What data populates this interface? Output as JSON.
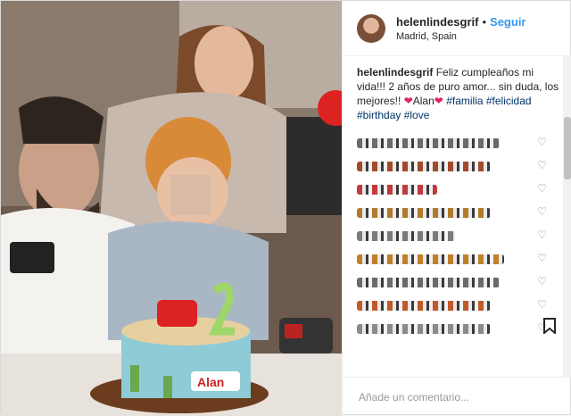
{
  "header": {
    "username": "helenlindesgrif",
    "dot": "•",
    "follow": "Seguir",
    "location": "Madrid, Spain"
  },
  "caption": {
    "username": "helenlindesgrif",
    "text_1": "Feliz cumpleaños mi vida!!! 2 años de puro amor... sin duda, los mejores!! ",
    "heart": "❤",
    "name": "Alan",
    "heart2": "❤",
    "tags": "#familia #felicidad #birthday #love"
  },
  "comments": [
    {
      "blur_color": "#6a6a6a"
    },
    {
      "blur_color": "#a34a2a"
    },
    {
      "blur_color": "#c23a3a"
    },
    {
      "blur_color": "#b07b2a"
    },
    {
      "blur_color": "#7a7a7a"
    },
    {
      "blur_color": "#c0802a"
    },
    {
      "blur_color": "#6a6a6a"
    },
    {
      "blur_color": "#c05a2a"
    },
    {
      "blur_color": "#8a8a8a"
    }
  ],
  "icons": {
    "like": "♡",
    "save": "🔖"
  },
  "photo": {
    "cake_label": "Alan"
  },
  "footer": {
    "placeholder": "Añade un comentario..."
  }
}
